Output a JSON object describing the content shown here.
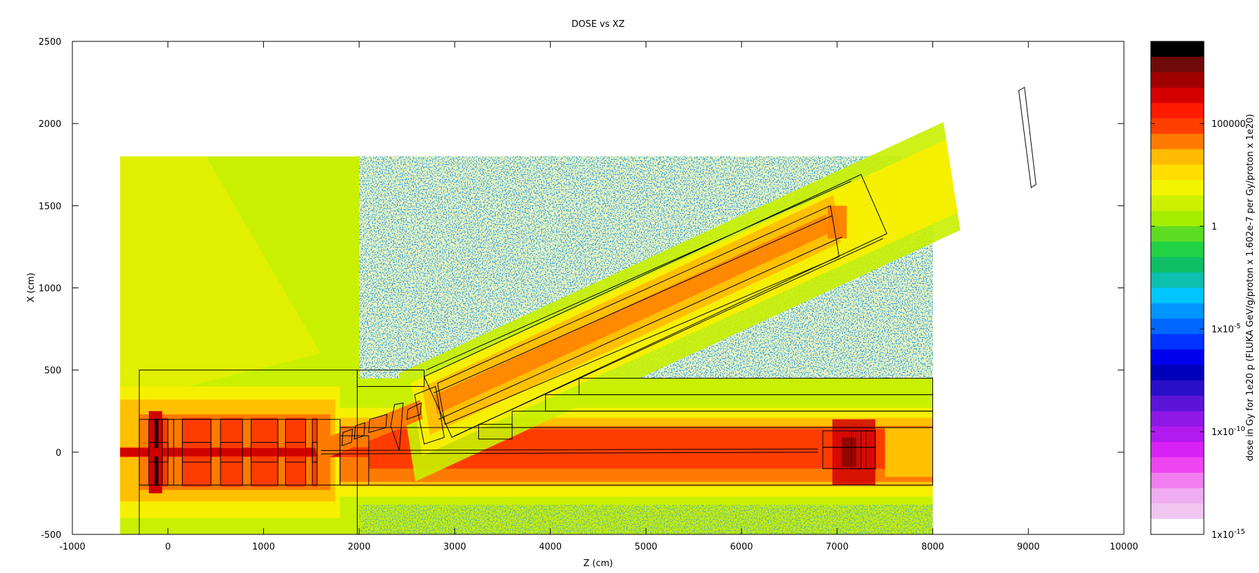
{
  "chart_data": {
    "type": "heatmap",
    "title": "DOSE vs XZ",
    "xlabel": "Z (cm)",
    "ylabel": "X (cm)",
    "xlim": [
      -1000,
      10000
    ],
    "ylim": [
      -500,
      2500
    ],
    "xticks": [
      -1000,
      0,
      1000,
      2000,
      3000,
      4000,
      5000,
      6000,
      7000,
      8000,
      9000,
      10000
    ],
    "xtick_labels": [
      "-1000",
      "0",
      "1000",
      "2000",
      "3000",
      "4000",
      "5000",
      "6000",
      "7000",
      "8000",
      "9000",
      "10000"
    ],
    "yticks": [
      -500,
      0,
      500,
      1000,
      1500,
      2000,
      2500
    ],
    "ytick_labels": [
      "-500",
      "0",
      "500",
      "1000",
      "1500",
      "2000",
      "2500"
    ],
    "grid": false,
    "scoring_region": {
      "z": [
        -500,
        8000
      ],
      "x": [
        -500,
        1800
      ]
    },
    "colorbar": {
      "label": "dose in Gy for 1e20 p (FLUKA GeV/g/proton x 1.602e-7 per Gy/proton x 1e20)",
      "scale": "log",
      "range": [
        1e-15,
        1000000000.0
      ],
      "ticks": [
        {
          "value_exp": 5,
          "label": "100000"
        },
        {
          "value_exp": 0,
          "label": "1"
        },
        {
          "value_exp": -5,
          "label": "1x10",
          "sup": "-5"
        },
        {
          "value_exp": -10,
          "label": "1x10",
          "sup": "-10"
        },
        {
          "value_exp": -15,
          "label": "1x10",
          "sup": "-15"
        }
      ],
      "colors_top_to_bottom": [
        "#000000",
        "#6e0a0a",
        "#a10000",
        "#d40000",
        "#ff1a00",
        "#ff3e00",
        "#ff7a00",
        "#ffbb00",
        "#ffde00",
        "#f3f500",
        "#ccf000",
        "#a6ee00",
        "#5ddd22",
        "#22d244",
        "#0fbe66",
        "#0dbfae",
        "#00c6ff",
        "#0095ff",
        "#0066ff",
        "#0033ff",
        "#0000ee",
        "#0000bb",
        "#2a0fc9",
        "#5c14d9",
        "#8f18e6",
        "#b31aef",
        "#d822f5",
        "#ef45f2",
        "#f07ef0",
        "#f0acf0",
        "#f0c6f0",
        "#ffffff"
      ]
    },
    "dose_colors": {
      "core": "#1a0000",
      "very_high": "#d10000",
      "high": "#ff3c00",
      "medium_high": "#ff7a00",
      "medium": "#ffc000",
      "low": "#f5f000",
      "lower": "#c8f000",
      "tail": "#5fdc2a",
      "very_low": "#13b8a8",
      "sparse": "#1f5ee8"
    }
  }
}
